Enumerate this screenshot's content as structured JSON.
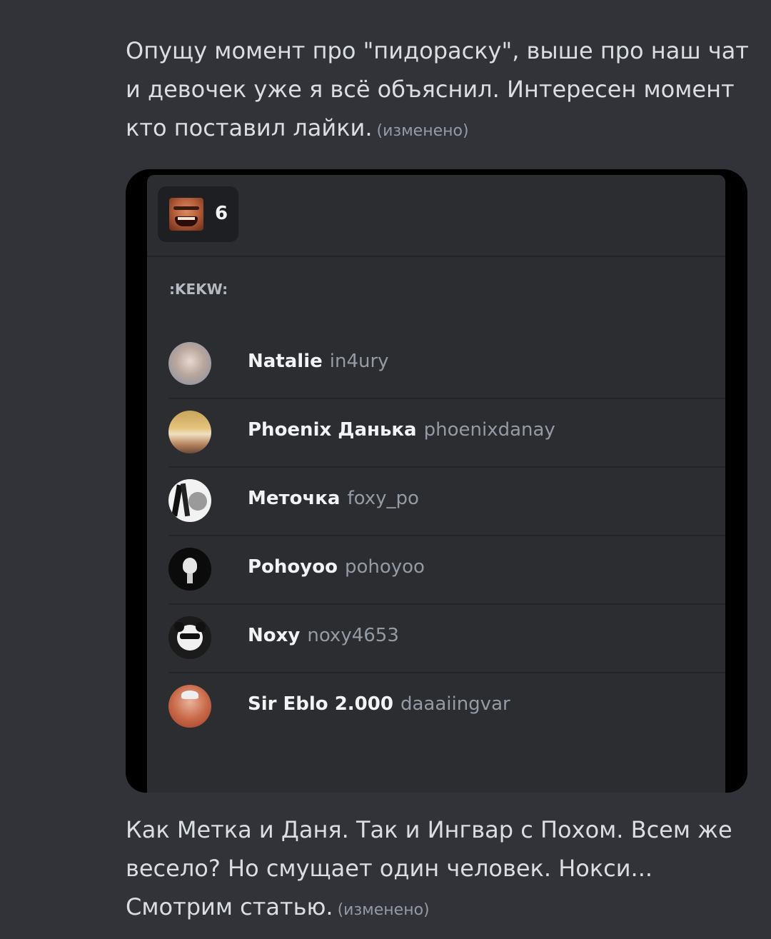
{
  "messages": {
    "top": {
      "text": "Опущу момент про \"пидораску\", выше про наш чат и девочек уже я всё объяснил. Интересен момент кто поставил лайки.",
      "edited": "(изменено)"
    },
    "bottom": {
      "text": "Как Метка и Даня. Так и Ингвар с Похом. Всем же весело? Но смущает один человек. Нокси... Смотрим статью.",
      "edited": "(изменено)"
    }
  },
  "attachment": {
    "reaction": {
      "emoji_icon": "kekw-emoji-icon",
      "count": "6"
    },
    "section_label": ":KEKW:",
    "users": [
      {
        "name": "Natalie",
        "handle": "in4ury"
      },
      {
        "name": "Phoenix Данька",
        "handle": "phoenixdanay"
      },
      {
        "name": "Меточка",
        "handle": "foxy_po"
      },
      {
        "name": "Pohoyoo",
        "handle": "pohoyoo"
      },
      {
        "name": "Noxy",
        "handle": "noxy4653"
      },
      {
        "name": "Sir Eblo 2.000",
        "handle": "daaaiingvar"
      }
    ]
  },
  "colors": {
    "background": "#313338",
    "panel": "#2b2d31",
    "pill": "#1e1f22",
    "text": "#dbdee1",
    "muted": "#949ba4"
  }
}
